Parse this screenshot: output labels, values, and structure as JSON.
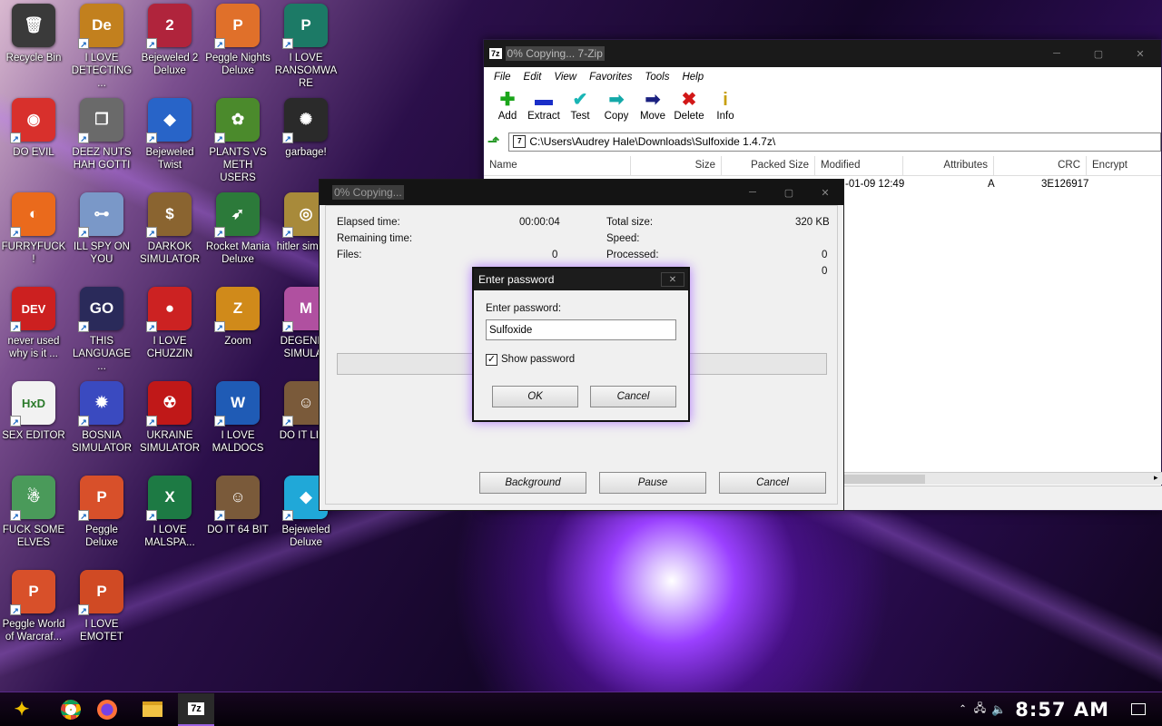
{
  "desktop_icons": [
    {
      "label": "Recycle Bin",
      "glyph": "🗑",
      "color": "#3a3a3a",
      "icon": "recycle-bin-icon"
    },
    {
      "label": "I LOVE DETECTING ...",
      "glyph": "De",
      "color": "#c2801e",
      "icon": "app-de-icon"
    },
    {
      "label": "Bejeweled 2 Deluxe",
      "glyph": "2",
      "color": "#b0243c",
      "icon": "bejeweled2-icon"
    },
    {
      "label": "Peggle Nights Deluxe",
      "glyph": "P",
      "color": "#e0702a",
      "icon": "peggle-nights-icon"
    },
    {
      "label": "I LOVE RANSOMWARE",
      "glyph": "P",
      "color": "#1c7a66",
      "icon": "publisher-icon"
    },
    {
      "label": "DO EVIL",
      "glyph": "◉",
      "color": "#d8302c",
      "icon": "chrome-icon"
    },
    {
      "label": "DEEZ NUTS HAH GOTTI",
      "glyph": "❐",
      "color": "#6a6a6a",
      "icon": "windows-stack-icon"
    },
    {
      "label": "Bejeweled Twist",
      "glyph": "◆",
      "color": "#2864c8",
      "icon": "bejeweled-twist-icon"
    },
    {
      "label": "PLANTS VS METH USERS",
      "glyph": "✿",
      "color": "#4b8a2c",
      "icon": "plants-icon"
    },
    {
      "label": "garbage!",
      "glyph": "✺",
      "color": "#2a2a2a",
      "icon": "garbage-icon"
    },
    {
      "label": "FURRYFUCK!",
      "glyph": "◐",
      "color": "#ea6a1c",
      "icon": "firefox-icon"
    },
    {
      "label": "ILL SPY ON YOU",
      "glyph": "⊶",
      "color": "#7a98c8",
      "icon": "network-icon"
    },
    {
      "label": "DARKOK SIMULATOR",
      "glyph": "$",
      "color": "#8a6430",
      "icon": "money-bag-icon"
    },
    {
      "label": "Rocket Mania Deluxe",
      "glyph": "➶",
      "color": "#2c7a3a",
      "icon": "rocket-icon"
    },
    {
      "label": "hitler simul...",
      "glyph": "◎",
      "color": "#a88a3a",
      "icon": "coin-icon"
    },
    {
      "label": "never used why is it ...",
      "glyph": "DEV",
      "color": "#cc2020",
      "icon": "devcpp-icon"
    },
    {
      "label": "THIS LANGUAGE ...",
      "glyph": "GO",
      "color": "#2a2a5a",
      "icon": "goland-icon"
    },
    {
      "label": "I LOVE CHUZZIN",
      "glyph": "●",
      "color": "#cc2222",
      "icon": "chuzzle-icon"
    },
    {
      "label": "Zoom",
      "glyph": "Z",
      "color": "#d08a1a",
      "icon": "zuma-icon"
    },
    {
      "label": "DEGENER SIMULAT",
      "glyph": "M",
      "color": "#b050a0",
      "icon": "degener-icon"
    },
    {
      "label": "SEX EDITOR",
      "glyph": "HxD",
      "color": "#f2f2f2",
      "icon": "hxd-icon"
    },
    {
      "label": "BOSNIA SIMULATOR",
      "glyph": "✹",
      "color": "#3a4ac0",
      "icon": "mine-icon"
    },
    {
      "label": "UKRAINE SIMULATOR",
      "glyph": "☢",
      "color": "#c01818",
      "icon": "radiation-icon"
    },
    {
      "label": "I LOVE MALDOCS",
      "glyph": "W",
      "color": "#1f5bb5",
      "icon": "word-icon"
    },
    {
      "label": "DO IT LIVE",
      "glyph": "☺",
      "color": "#7a5a3a",
      "icon": "portrait-icon"
    },
    {
      "label": "FUCK SOME ELVES",
      "glyph": "☃",
      "color": "#4a9a5a",
      "icon": "elves-icon"
    },
    {
      "label": "Peggle Deluxe",
      "glyph": "P",
      "color": "#d8502a",
      "icon": "peggle-icon"
    },
    {
      "label": "I LOVE MALSPA...",
      "glyph": "X",
      "color": "#1d7a44",
      "icon": "excel-icon"
    },
    {
      "label": "DO IT 64 BIT",
      "glyph": "☺",
      "color": "#7a5a3a",
      "icon": "portrait64-icon"
    },
    {
      "label": "Bejeweled Deluxe",
      "glyph": "◆",
      "color": "#20a8d8",
      "icon": "bejeweled-icon"
    },
    {
      "label": "Peggle World of Warcraf...",
      "glyph": "P",
      "color": "#d8502a",
      "icon": "peggle-wow-icon"
    },
    {
      "label": "I LOVE EMOTET",
      "glyph": "P",
      "color": "#d04a24",
      "icon": "powerpoint-icon"
    }
  ],
  "zip_window": {
    "title": "0% Copying... 7-Zip",
    "app_badge": "7z",
    "menu": [
      "File",
      "Edit",
      "View",
      "Favorites",
      "Tools",
      "Help"
    ],
    "toolbar": [
      {
        "label": "Add",
        "glyph": "✚",
        "color": "#1aa51a"
      },
      {
        "label": "Extract",
        "glyph": "▬",
        "color": "#1a2ec8"
      },
      {
        "label": "Test",
        "glyph": "✔",
        "color": "#19b5b5"
      },
      {
        "label": "Copy",
        "glyph": "➡",
        "color": "#13a8a8"
      },
      {
        "label": "Move",
        "glyph": "➡",
        "color": "#1a2080"
      },
      {
        "label": "Delete",
        "glyph": "✖",
        "color": "#d21818"
      },
      {
        "label": "Info",
        "glyph": "i",
        "color": "#c8a010"
      }
    ],
    "path": "C:\\Users\\Audrey Hale\\Downloads\\Sulfoxide 1.4.7z\\",
    "columns": [
      "Name",
      "Size",
      "Packed Size",
      "Modified",
      "Attributes",
      "CRC",
      "Encrypt"
    ],
    "row": {
      "modified": "-01-09 12:49",
      "attributes": "A",
      "crc": "3E126917"
    }
  },
  "progress_dialog": {
    "title": "0% Copying...",
    "elapsed_label": "Elapsed time:",
    "elapsed_value": "00:00:04",
    "remaining_label": "Remaining time:",
    "files_label": "Files:",
    "files_value": "0",
    "total_label": "Total size:",
    "total_value": "320 KB",
    "speed_label": "Speed:",
    "processed_label": "Processed:",
    "processed_value": "0",
    "extra_value": "0",
    "background_btn": "Background",
    "pause_btn": "Pause",
    "cancel_btn": "Cancel"
  },
  "password_dialog": {
    "title": "Enter password",
    "prompt": "Enter password:",
    "value": "Sulfoxide",
    "show_password": "Show password",
    "show_checked": true,
    "ok": "OK",
    "cancel": "Cancel"
  },
  "taskbar": {
    "time": "8:57 AM"
  }
}
